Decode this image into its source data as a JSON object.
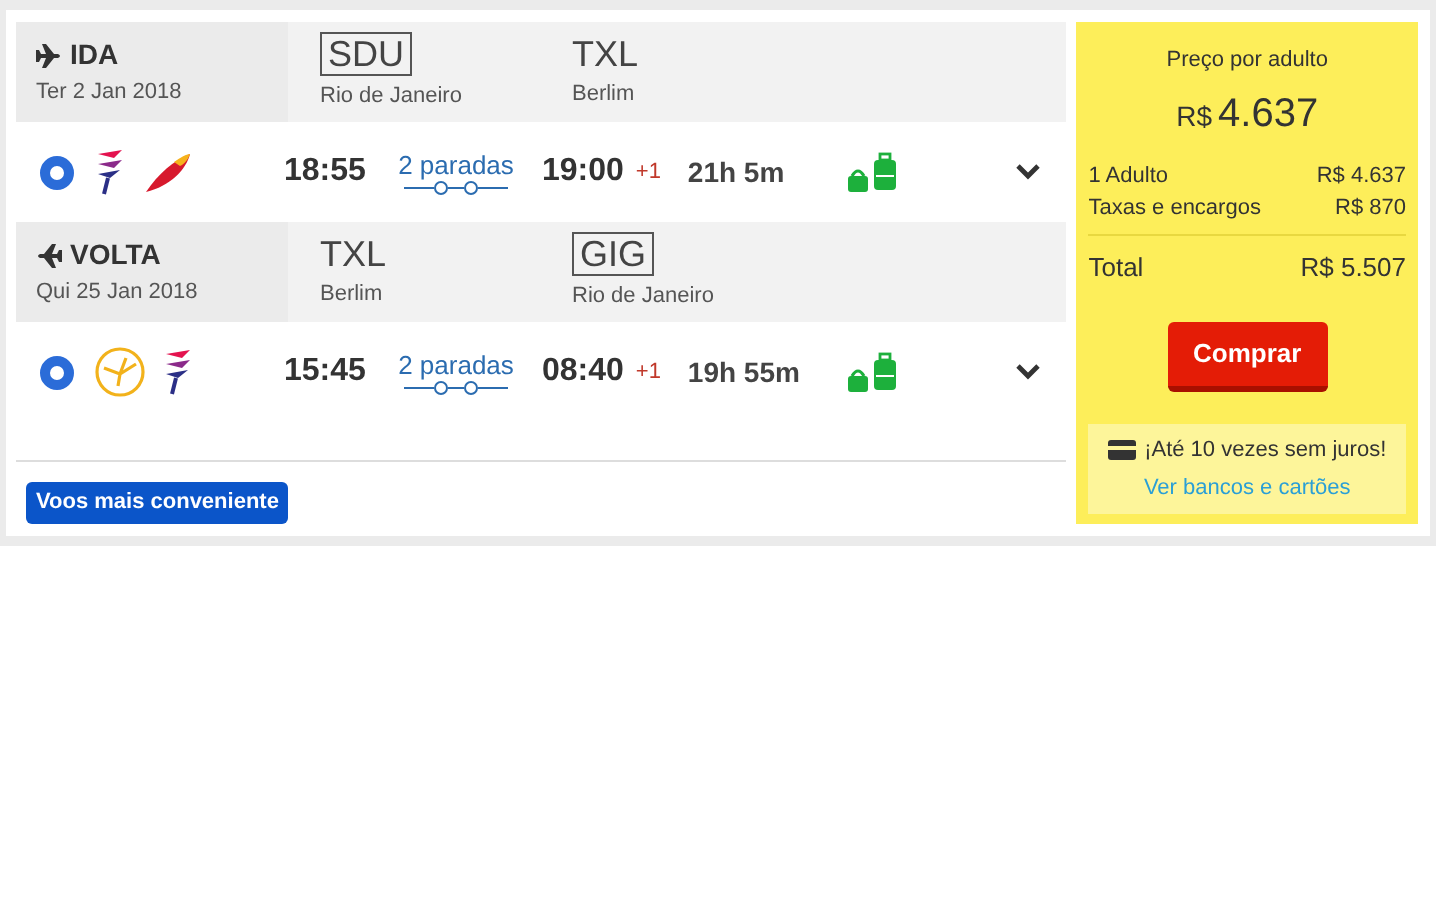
{
  "legs": [
    {
      "kind": "outbound",
      "direction": "IDA",
      "date": "Ter 2 Jan 2018",
      "from": {
        "code": "SDU",
        "city": "Rio de Janeiro",
        "boxed": true
      },
      "to": {
        "code": "TXL",
        "city": "Berlim",
        "boxed": false
      },
      "flight": {
        "selected": true,
        "logos": [
          {
            "kind": "striped"
          },
          {
            "kind": "swoosh"
          }
        ],
        "depart": "18:55",
        "stops": "2 paradas",
        "arrive": "19:00",
        "day_offset": "+1",
        "duration": "21h 5m"
      }
    },
    {
      "kind": "return",
      "direction": "VOLTA",
      "date": "Qui 25 Jan 2018",
      "from": {
        "code": "TXL",
        "city": "Berlim",
        "boxed": false
      },
      "to": {
        "code": "GIG",
        "city": "Rio de Janeiro",
        "boxed": true
      },
      "flight": {
        "selected": true,
        "logos": [
          {
            "kind": "crane"
          },
          {
            "kind": "striped"
          }
        ],
        "depart": "15:45",
        "stops": "2 paradas",
        "arrive": "08:40",
        "day_offset": "+1",
        "duration": "19h 55m"
      }
    }
  ],
  "tag": "Voos mais conveniente",
  "price": {
    "label": "Preço por adulto",
    "currency": "R$",
    "amount": "4.637",
    "lines": [
      {
        "label": "1 Adulto",
        "value": "R$ 4.637"
      },
      {
        "label": "Taxas e encargos",
        "value": "R$ 870"
      }
    ],
    "total_label": "Total",
    "total_value": "R$ 5.507",
    "buy_button": "Comprar",
    "installments": "¡Até 10 vezes sem juros!",
    "link": "Ver bancos e cartões"
  }
}
